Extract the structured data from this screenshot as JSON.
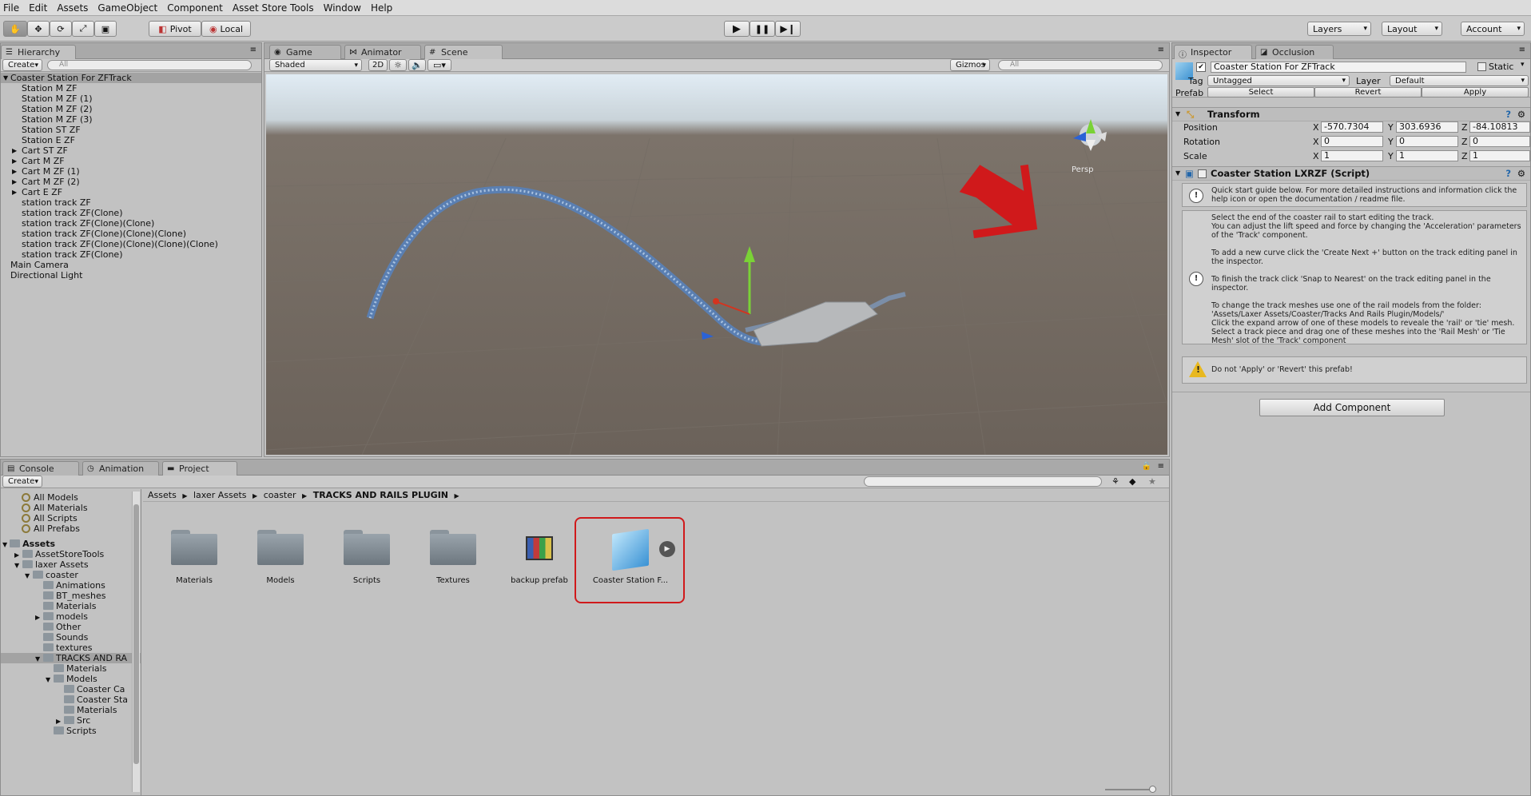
{
  "menu": [
    "File",
    "Edit",
    "Assets",
    "GameObject",
    "Component",
    "Asset Store Tools",
    "Window",
    "Help"
  ],
  "toolbar": {
    "pivot": "Pivot",
    "local": "Local",
    "layers": "Layers",
    "layout": "Layout",
    "account": "Account"
  },
  "hierarchy": {
    "tab": "Hierarchy",
    "create": "Create",
    "search_placeholder": "All",
    "root": "Coaster Station For ZFTrack",
    "children": [
      "Station M ZF",
      "Station M ZF (1)",
      "Station M ZF (2)",
      "Station M ZF (3)",
      "Station ST ZF",
      "Station E ZF"
    ],
    "expandable": [
      "Cart ST ZF",
      "Cart M ZF",
      "Cart M ZF (1)",
      "Cart M ZF (2)",
      "Cart E ZF"
    ],
    "tracks": [
      "station track ZF",
      "station track ZF(Clone)",
      "station track ZF(Clone)(Clone)",
      "station track ZF(Clone)(Clone)(Clone)",
      "station track ZF(Clone)(Clone)(Clone)(Clone)",
      "station track ZF(Clone)"
    ],
    "top_level": [
      "Main Camera",
      "Directional Light"
    ]
  },
  "scene_tabs": {
    "game": "Game",
    "animator": "Animator",
    "scene": "Scene",
    "shaded": "Shaded",
    "two_d": "2D",
    "gizmos": "Gizmos",
    "search_placeholder": "All",
    "persp": "Persp"
  },
  "inspector": {
    "tab": "Inspector",
    "occlusion_tab": "Occlusion",
    "name": "Coaster Station For ZFTrack",
    "static": "Static",
    "tag_label": "Tag",
    "tag": "Untagged",
    "layer_label": "Layer",
    "layer": "Default",
    "prefab_label": "Prefab",
    "select": "Select",
    "revert": "Revert",
    "apply": "Apply",
    "transform": "Transform",
    "position_label": "Position",
    "pos_x": "-570.7304",
    "pos_y": "303.6936",
    "pos_z": "-84.10813",
    "rotation_label": "Rotation",
    "rot_x": "0",
    "rot_y": "0",
    "rot_z": "0",
    "scale_label": "Scale",
    "scl_x": "1",
    "scl_y": "1",
    "scl_z": "1",
    "x": "X",
    "y": "Y",
    "z": "Z",
    "script": "Coaster Station LXRZF (Script)",
    "help1": "Quick start guide below. For more detailed instructions and information click the help icon or open the documentation / readme file.",
    "help2a": "Select the end of the coaster rail to start editing the track.",
    "help2b": "You can adjust the lift speed and force by changing the 'Acceleration' parameters of the 'Track' component.",
    "help2c": "To add a new curve click the 'Create Next +' button on the track editing panel in the inspector.",
    "help2d": "To finish the track click 'Snap to Nearest' on the track editing panel in the inspector.",
    "help2e": "To change the track meshes use one of the rail models from the folder: 'Assets/Laxer Assets/Coaster/Tracks And Rails Plugin/Models/'",
    "help2f": "Click the expand arrow of one of these models to reveale the 'rail' or 'tie' mesh.",
    "help2g": "Select a track piece and drag one of these meshes into the 'Rail Mesh' or 'Tie Mesh' slot of the 'Track' component",
    "warning": "Do not 'Apply' or 'Revert' this prefab!",
    "add_component": "Add Component"
  },
  "bottom_tabs": {
    "console": "Console",
    "animation": "Animation",
    "project": "Project",
    "create": "Create"
  },
  "project": {
    "favorites": [
      "All Models",
      "All Materials",
      "All Scripts",
      "All Prefabs"
    ],
    "assets": "Assets",
    "tree": [
      {
        "label": "AssetStoreTools",
        "d": 1,
        "a": "▶"
      },
      {
        "label": "laxer Assets",
        "d": 1,
        "a": "▼"
      },
      {
        "label": "coaster",
        "d": 2,
        "a": "▼"
      },
      {
        "label": "Animations",
        "d": 3,
        "a": ""
      },
      {
        "label": "BT_meshes",
        "d": 3,
        "a": ""
      },
      {
        "label": "Materials",
        "d": 3,
        "a": ""
      },
      {
        "label": "models",
        "d": 3,
        "a": "▶"
      },
      {
        "label": "Other",
        "d": 3,
        "a": ""
      },
      {
        "label": "Sounds",
        "d": 3,
        "a": ""
      },
      {
        "label": "textures",
        "d": 3,
        "a": ""
      },
      {
        "label": "TRACKS AND RA",
        "d": 3,
        "a": "▼",
        "sel": true
      },
      {
        "label": "Materials",
        "d": 4,
        "a": ""
      },
      {
        "label": "Models",
        "d": 4,
        "a": "▼"
      },
      {
        "label": "Coaster Ca",
        "d": 5,
        "a": ""
      },
      {
        "label": "Coaster Sta",
        "d": 5,
        "a": ""
      },
      {
        "label": "Materials",
        "d": 5,
        "a": ""
      },
      {
        "label": "Src",
        "d": 5,
        "a": "▶"
      },
      {
        "label": "Scripts",
        "d": 4,
        "a": ""
      }
    ],
    "breadcrumb": [
      "Assets",
      "laxer Assets",
      "coaster",
      "TRACKS AND RAILS PLUGIN"
    ],
    "items": [
      "Materials",
      "Models",
      "Scripts",
      "Textures",
      "backup prefab",
      "Coaster Station F..."
    ]
  },
  "colors": {
    "accent_red": "#d0191b",
    "selection": "#3e7ed6"
  }
}
